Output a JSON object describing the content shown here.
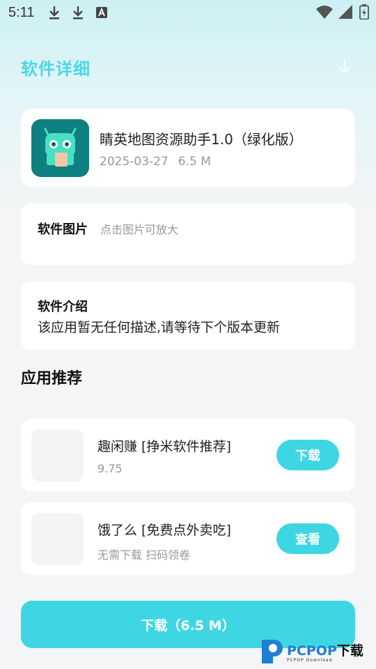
{
  "status_bar": {
    "time": "5:11",
    "left_icons": [
      "download-icon",
      "download-icon",
      "text-a-icon"
    ],
    "right_icons": [
      "wifi-icon",
      "signal-icon",
      "battery-icon"
    ]
  },
  "header": {
    "title": "软件详细",
    "title_color": "#4ed6e4",
    "download_icon": "download-arrow-icon"
  },
  "app": {
    "name": "睛英地图资源助手1.0（绿化版）",
    "date": "2025-03-27",
    "size": "6.5 M",
    "icon": "android-robot-icon"
  },
  "screenshots": {
    "label": "软件图片",
    "hint": "点击图片可放大"
  },
  "intro": {
    "label": "软件介绍",
    "text": "该应用暂无任何描述,请等待下个版本更新"
  },
  "recommendations": {
    "title": "应用推荐",
    "items": [
      {
        "name": "趣闲赚 [挣米软件推荐]",
        "sub": "9.75",
        "button": "下载"
      },
      {
        "name": "饿了么 [免费点外卖吃]",
        "sub": "无需下载 扫码领卷",
        "button": "查看"
      }
    ]
  },
  "main_button": {
    "label": "下载（6.5 M）"
  },
  "watermark": {
    "brand": "PCPOP",
    "suffix": "下载",
    "sub": "PCPOP Download"
  },
  "colors": {
    "accent": "#3fd6e3",
    "background": "#f3f5f6",
    "app_icon_bg": "#0e807f"
  }
}
